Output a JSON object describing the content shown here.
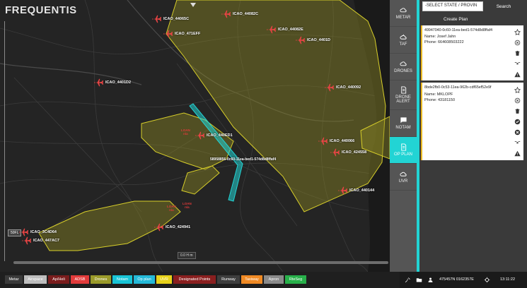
{
  "app": {
    "logo": "FREQUENTIS"
  },
  "map": {
    "scale_label": "0.0 H m",
    "altitude_chip": "50FL",
    "plan_id": "58958856-0c60-11ea-bed1-574d8d8ffaf4",
    "red_labels": [
      {
        "text": "LOAN\nn/a"
      },
      {
        "text": "LOAN\nn/a"
      },
      {
        "text": "LOAN\nn/a"
      }
    ],
    "flights": [
      {
        "label": "ICAO_44065C"
      },
      {
        "label": "ICAO_44082C"
      },
      {
        "label": "ICAO_471EFF"
      },
      {
        "label": "ICAO_44082E"
      },
      {
        "label": "ICAO_4401D"
      },
      {
        "label": "ICAO_4401D2"
      },
      {
        "label": "ICAO_440092"
      },
      {
        "label": "ICAO_440ED1"
      },
      {
        "label": "ICAO_440066"
      },
      {
        "label": "ICAO_424558"
      },
      {
        "label": "ICAO_440144"
      },
      {
        "label": "ICAO_424941"
      },
      {
        "label": "ICAO_3C4D64"
      },
      {
        "label": "ICAO_447AC7"
      }
    ]
  },
  "rail": {
    "items": [
      {
        "label": "METAR",
        "icon": "cloud-sync-icon"
      },
      {
        "label": "TAF",
        "icon": "cloud-sun-icon"
      },
      {
        "label": "DRONES",
        "icon": "cloud-sync-icon"
      },
      {
        "label": "DRONE ALERT",
        "icon": "document-icon"
      },
      {
        "label": "NOTAM",
        "icon": "chat-icon"
      },
      {
        "label": "OP PLAN",
        "icon": "document-icon"
      },
      {
        "label": "UVR",
        "icon": "cloud-icon"
      }
    ]
  },
  "panel": {
    "select_value": "-SELECT STATE / PROVIN",
    "search_label": "Search",
    "create_label": "Create Plan",
    "cards": [
      {
        "uuid": "49947040-0c60-11ea-bed1-574d8d8ffaf4",
        "name": "Name: Josef Jahn",
        "phone": "Phone: 664608503222"
      },
      {
        "uuid": "8bde2fb0-0c53-11ea-962b-cdf65ef52e9f",
        "name": "Name: MKLOPF",
        "phone": "Phone: 43181150"
      }
    ]
  },
  "legend": [
    {
      "label": "Metar",
      "color": "#3a3a3a"
    },
    {
      "label": "Airspace",
      "color": "#bdbdbd"
    },
    {
      "label": "Ap/Heli",
      "color": "#7a1d1d"
    },
    {
      "label": "ADSB",
      "color": "#e23b3b"
    },
    {
      "label": "Drones",
      "color": "#9a9a2a"
    },
    {
      "label": "Notam",
      "color": "#18c4d6"
    },
    {
      "label": "Op plan",
      "color": "#24b9d8"
    },
    {
      "label": "UVR",
      "color": "#e8d21a"
    },
    {
      "label": "Designated Points",
      "color": "#8a1f1f"
    },
    {
      "label": "Runway",
      "color": "#3e3e3e"
    },
    {
      "label": "Taxiway",
      "color": "#f08a24"
    },
    {
      "label": "Apron",
      "color": "#8a8a8a"
    },
    {
      "label": "RteSeg",
      "color": "#28b04a"
    }
  ],
  "status": {
    "coords": "475457N 0162357E",
    "time": "13:11:22"
  }
}
